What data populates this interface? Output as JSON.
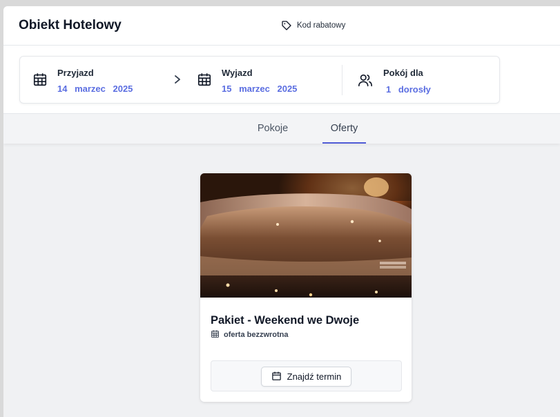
{
  "header": {
    "brand": "Obiekt Hotelowy",
    "promo_label": "Kod rabatowy"
  },
  "search": {
    "arrival": {
      "label": "Przyjazd",
      "value": "14 marzec 2025"
    },
    "departure": {
      "label": "Wyjazd",
      "value": "15 marzec 2025"
    },
    "room": {
      "label": "Pokój dla",
      "value": "1 dorosły"
    }
  },
  "tabs": [
    {
      "label": "Pokoje",
      "active": false
    },
    {
      "label": "Oferty",
      "active": true
    }
  ],
  "offer": {
    "title": "Pakiet - Weekend we Dwoje",
    "subtitle": "oferta bezzwrotna",
    "button_label": "Znajdź termin"
  },
  "colors": {
    "accent": "#5b6ee1",
    "tab_underline": "#4f5bd5"
  }
}
